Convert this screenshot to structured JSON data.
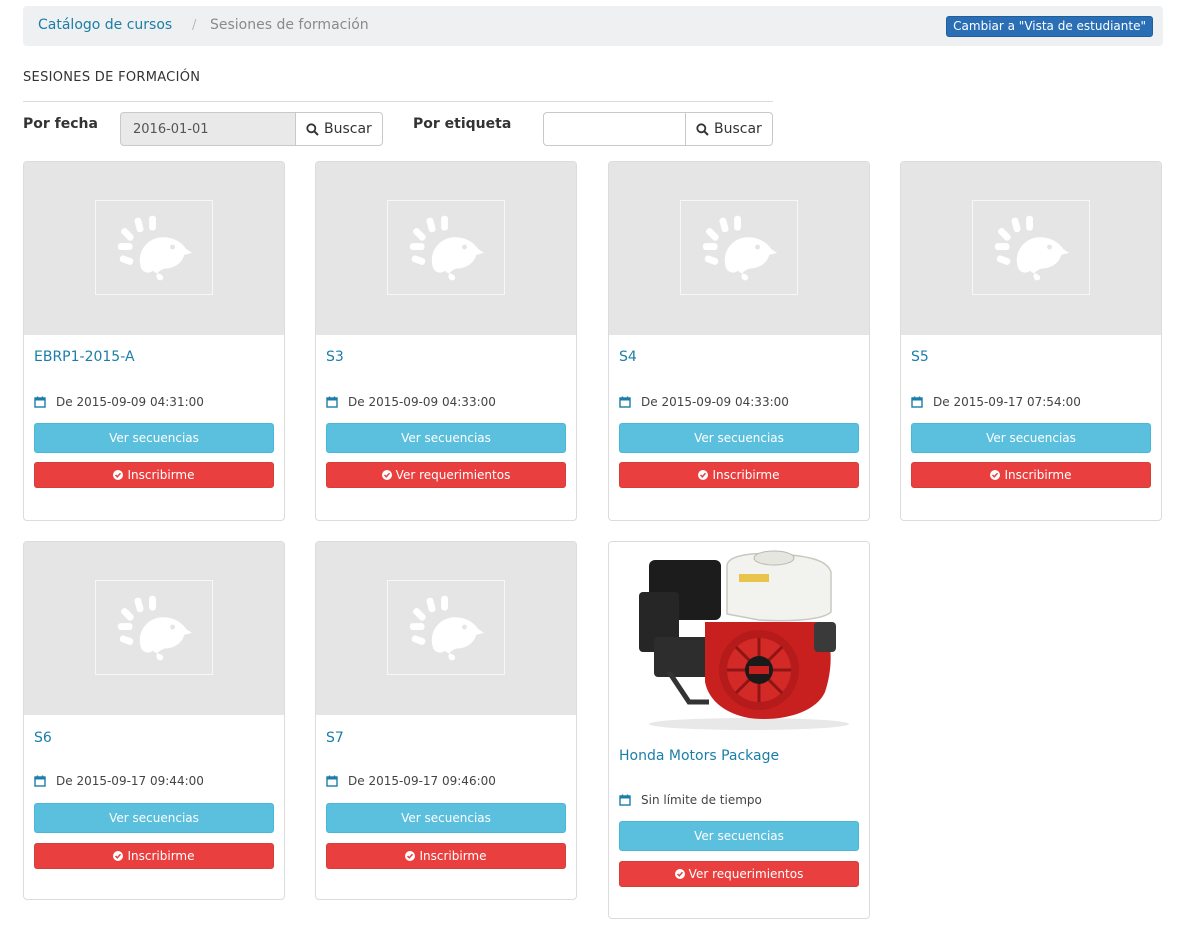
{
  "breadcrumb": {
    "catalog": "Catálogo de cursos",
    "separator": "/",
    "current": "Sesiones de formación"
  },
  "switch_view_button": "Cambiar a \"Vista de estudiante\"",
  "section_title": "SESIONES DE FORMACIÓN",
  "filters": {
    "by_date_label": "Por fecha",
    "by_date_value": "2016-01-01",
    "by_tag_label": "Por etiqueta",
    "by_tag_value": "",
    "search_label": "Buscar"
  },
  "sessions": [
    {
      "title": "EBRP1-2015-A",
      "date": "De 2015-09-09 04:31:00",
      "sequences": "Ver secuencias",
      "action": "Inscribirme"
    },
    {
      "title": "S3",
      "date": "De 2015-09-09 04:33:00",
      "sequences": "Ver secuencias",
      "action": "Ver requerimientos"
    },
    {
      "title": "S4",
      "date": "De 2015-09-09 04:33:00",
      "sequences": "Ver secuencias",
      "action": "Inscribirme"
    },
    {
      "title": "S5",
      "date": "De 2015-09-17 07:54:00",
      "sequences": "Ver secuencias",
      "action": "Inscribirme"
    },
    {
      "title": "S6",
      "date": "De 2015-09-17 09:44:00",
      "sequences": "Ver secuencias",
      "action": "Inscribirme"
    },
    {
      "title": "S7",
      "date": "De 2015-09-17 09:46:00",
      "sequences": "Ver secuencias",
      "action": "Inscribirme"
    },
    {
      "title": "Honda Motors Package",
      "date": "Sin límite de tiempo",
      "sequences": "Ver secuencias",
      "action": "Ver requerimientos"
    }
  ],
  "colors": {
    "link": "#1b7ea8",
    "info": "#5bc0de",
    "danger": "#e93f3f",
    "primary": "#2a6fb6"
  }
}
